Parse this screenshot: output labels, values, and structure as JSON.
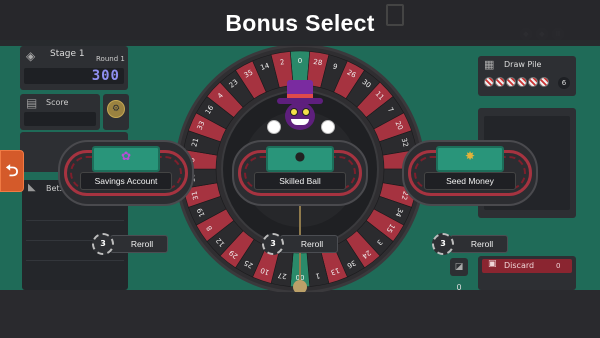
{
  "banner": {
    "title": "Bonus Select"
  },
  "hud": {
    "stage_label": "Stage 1",
    "round_label": "Round 1",
    "round_value": "300",
    "score_label": "Score",
    "bet_label": "Bet.",
    "draw_pile_label": "Draw Pile",
    "draw_pile_count": "6",
    "discard_label": "Discard",
    "discard_count": "0",
    "counter_left": "0",
    "counter_right": "0"
  },
  "icons": {
    "stage": "gem-icon",
    "score": "scroll-icon",
    "coin": "coin-icon",
    "bet": "chip-icon",
    "draw": "deck-icon",
    "discard": "trash-icon",
    "side_tab": "exit-icon"
  },
  "wheel": {
    "numbers": [
      "0",
      "28",
      "9",
      "26",
      "30",
      "11",
      "7",
      "20",
      "32",
      "17",
      "5",
      "22",
      "34",
      "15",
      "3",
      "24",
      "36",
      "13",
      "1",
      "00",
      "27",
      "10",
      "25",
      "29",
      "12",
      "8",
      "19",
      "31",
      "18",
      "6",
      "21",
      "33",
      "16",
      "4",
      "23",
      "35",
      "14",
      "2"
    ]
  },
  "bonuses": [
    {
      "name": "Savings Account",
      "icon": "piggy-bank-icon",
      "reroll_label": "Reroll",
      "reroll_cost": "3"
    },
    {
      "name": "Skilled Ball",
      "icon": "ball-icon",
      "reroll_label": "Reroll",
      "reroll_cost": "3"
    },
    {
      "name": "Seed Money",
      "icon": "money-bag-icon",
      "reroll_label": "Reroll",
      "reroll_cost": "3"
    }
  ],
  "colors": {
    "felt": "#1f6b58",
    "wheel_red": "#a63340",
    "wheel_black": "#2b2b2e",
    "wheel_green": "#2a8a6a",
    "accent_orange": "#d45a2a",
    "discard_red": "#8a2530",
    "round_digits": "#8f8ff0"
  }
}
